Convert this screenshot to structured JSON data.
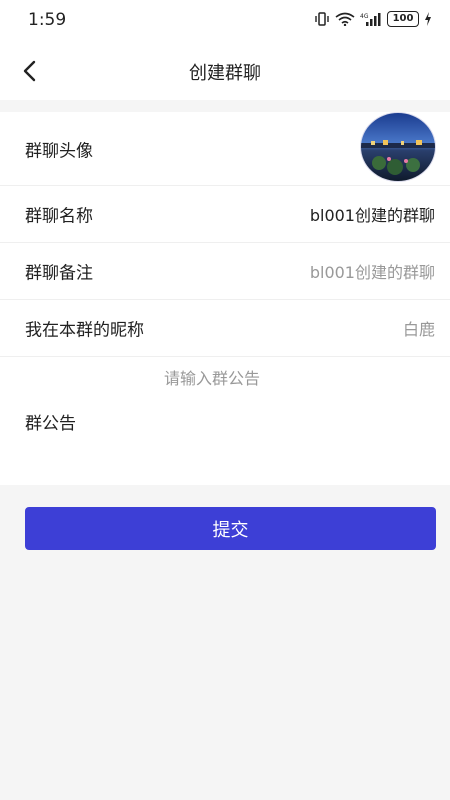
{
  "status_bar": {
    "time": "1:59",
    "battery": "100",
    "icons": [
      "vibrate-icon",
      "wifi-icon",
      "signal-4g-icon",
      "battery-icon",
      "charging-icon"
    ]
  },
  "header": {
    "title": "创建群聊",
    "back_icon": "chevron-left-icon"
  },
  "form": {
    "avatar_label": "群聊头像",
    "name_label": "群聊名称",
    "name_value": "bl001创建的群聊",
    "remark_label": "群聊备注",
    "remark_placeholder": "bl001创建的群聊",
    "nickname_label": "我在本群的昵称",
    "nickname_value": "白鹿",
    "notice_placeholder": "请输入群公告",
    "notice_label": "群公告"
  },
  "actions": {
    "submit_label": "提交"
  },
  "colors": {
    "accent": "#3d3fd6",
    "background": "#f5f5f5",
    "muted_text": "#999999"
  }
}
